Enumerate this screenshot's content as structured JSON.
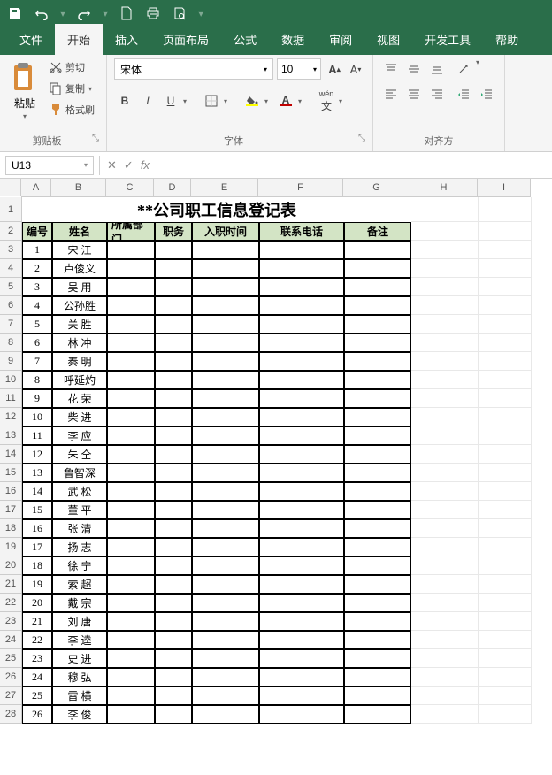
{
  "titlebar": {
    "icons": [
      "save",
      "undo",
      "redo",
      "new-doc",
      "print",
      "preview"
    ]
  },
  "tabs": [
    "文件",
    "开始",
    "插入",
    "页面布局",
    "公式",
    "数据",
    "审阅",
    "视图",
    "开发工具",
    "帮助"
  ],
  "active_tab": "开始",
  "clipboard": {
    "paste": "粘贴",
    "cut": "剪切",
    "copy": "复制",
    "format_painter": "格式刷",
    "group_label": "剪贴板"
  },
  "font": {
    "name": "宋体",
    "size": "10",
    "group_label": "字体",
    "wen_label": "wén"
  },
  "align": {
    "group_label": "对齐方"
  },
  "namebox": "U13",
  "fx_label": "fx",
  "columns": [
    "A",
    "B",
    "C",
    "D",
    "E",
    "F",
    "G",
    "H",
    "I"
  ],
  "col_widths": [
    "colA",
    "colB",
    "colC",
    "colD",
    "colE",
    "colF",
    "colG",
    "colH",
    "colI"
  ],
  "sheet": {
    "title": "**公司职工信息登记表",
    "headers": [
      "编号",
      "姓名",
      "所属部门",
      "职务",
      "入职时间",
      "联系电话",
      "备注"
    ],
    "rows": [
      {
        "num": "1",
        "name": "宋  江"
      },
      {
        "num": "2",
        "name": "卢俊义"
      },
      {
        "num": "3",
        "name": "吴  用"
      },
      {
        "num": "4",
        "name": "公孙胜"
      },
      {
        "num": "5",
        "name": "关  胜"
      },
      {
        "num": "6",
        "name": "林  冲"
      },
      {
        "num": "7",
        "name": "秦  明"
      },
      {
        "num": "8",
        "name": "呼延灼"
      },
      {
        "num": "9",
        "name": "花  荣"
      },
      {
        "num": "10",
        "name": "柴  进"
      },
      {
        "num": "11",
        "name": "李  应"
      },
      {
        "num": "12",
        "name": "朱  仝"
      },
      {
        "num": "13",
        "name": "鲁智深"
      },
      {
        "num": "14",
        "name": "武  松"
      },
      {
        "num": "15",
        "name": "董  平"
      },
      {
        "num": "16",
        "name": "张  清"
      },
      {
        "num": "17",
        "name": "扬  志"
      },
      {
        "num": "18",
        "name": "徐  宁"
      },
      {
        "num": "19",
        "name": "索  超"
      },
      {
        "num": "20",
        "name": "戴  宗"
      },
      {
        "num": "21",
        "name": "刘  唐"
      },
      {
        "num": "22",
        "name": "李  逵"
      },
      {
        "num": "23",
        "name": "史  进"
      },
      {
        "num": "24",
        "name": "穆  弘"
      },
      {
        "num": "25",
        "name": "雷  横"
      },
      {
        "num": "26",
        "name": "李  俊"
      }
    ]
  }
}
